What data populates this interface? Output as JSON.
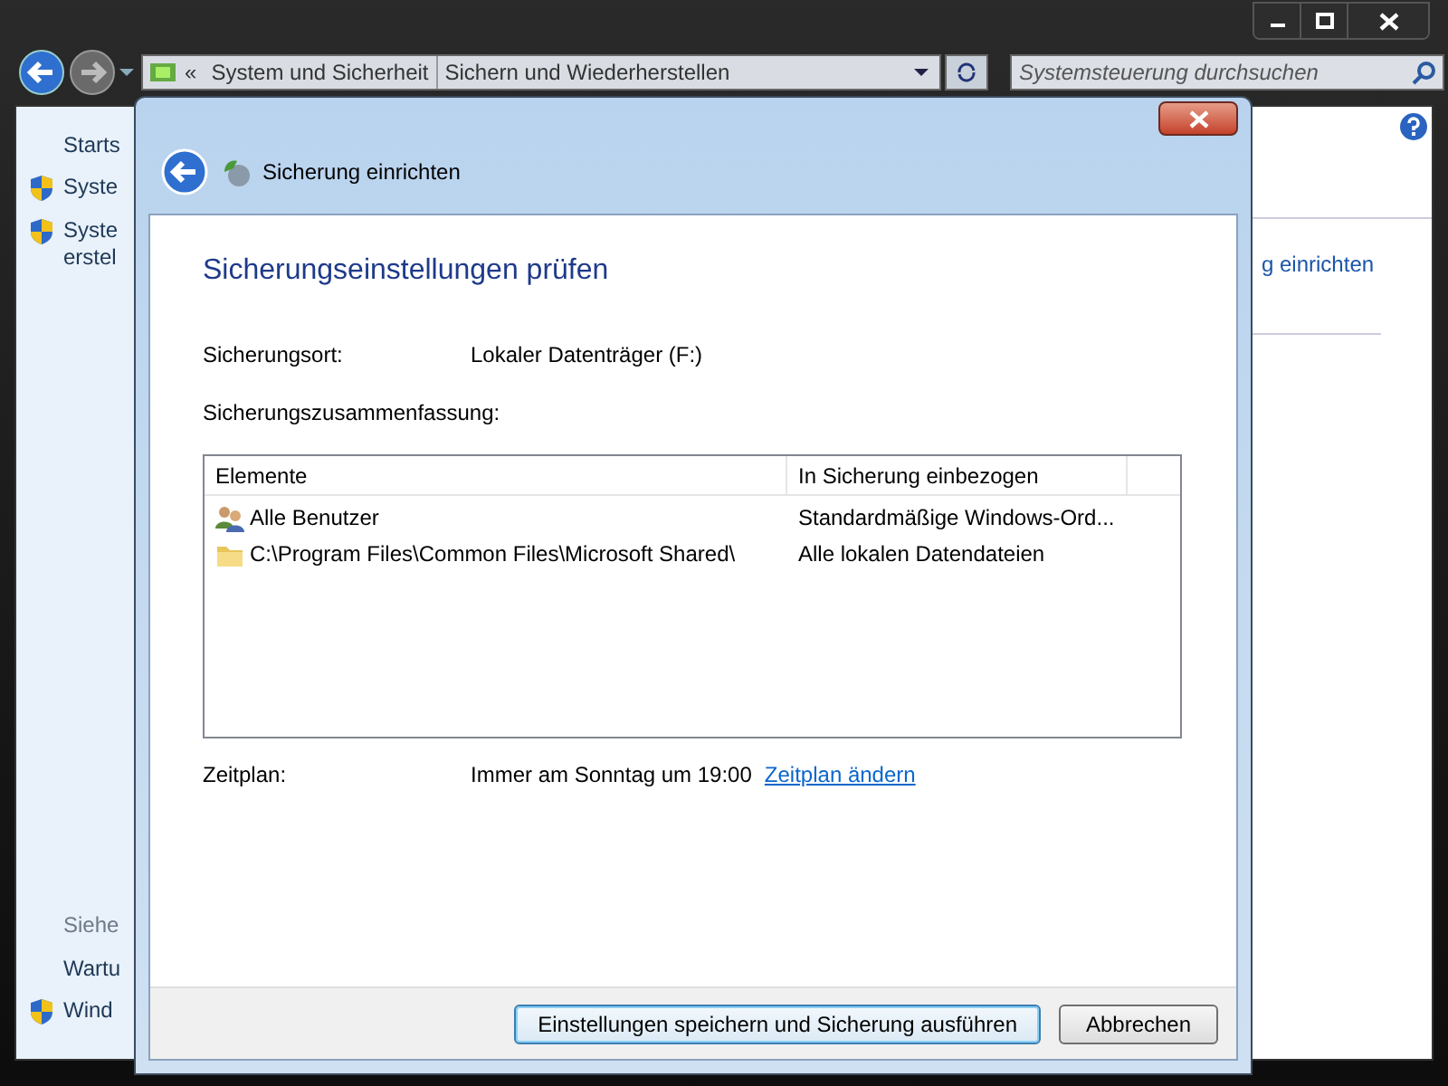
{
  "explorer": {
    "address_bar": {
      "overflow_marker": "«",
      "crumbs": [
        "System und Sicherheit",
        "Sichern und Wiederherstellen"
      ]
    },
    "search": {
      "placeholder": "Systemsteuerung durchsuchen"
    },
    "sidebar": {
      "items": [
        {
          "kind": "link",
          "lines": [
            "Starts"
          ]
        },
        {
          "kind": "shield",
          "lines": [
            "Syste"
          ]
        },
        {
          "kind": "shield",
          "lines": [
            "Syste",
            "erstel"
          ]
        }
      ],
      "see_also": {
        "heading": "Siehe",
        "items": [
          {
            "kind": "link",
            "lines": [
              "Wartu"
            ]
          },
          {
            "kind": "shield",
            "lines": [
              "Wind"
            ]
          }
        ]
      }
    },
    "content_link": "g einrichten"
  },
  "dialog": {
    "title": "Sicherung einrichten",
    "heading": "Sicherungseinstellungen prüfen",
    "location": {
      "label": "Sicherungsort:",
      "value": "Lokaler Datenträger (F:)"
    },
    "summary_label": "Sicherungszusammenfassung:",
    "table": {
      "columns": [
        "Elemente",
        "In Sicherung einbezogen"
      ],
      "rows": [
        {
          "kind": "users",
          "cells": [
            "Alle Benutzer",
            "Standardmäßige Windows-Ord..."
          ]
        },
        {
          "kind": "folder",
          "cells": [
            "C:\\Program Files\\Common Files\\Microsoft Shared\\",
            "Alle lokalen Datendateien"
          ]
        }
      ]
    },
    "schedule": {
      "label": "Zeitplan:",
      "value": "Immer am Sonntag um 19:00",
      "link": "Zeitplan ändern"
    },
    "buttons": [
      {
        "label": "Einstellungen speichern und Sicherung ausführen",
        "default": true
      },
      {
        "label": "Abbrechen",
        "default": false
      }
    ]
  }
}
